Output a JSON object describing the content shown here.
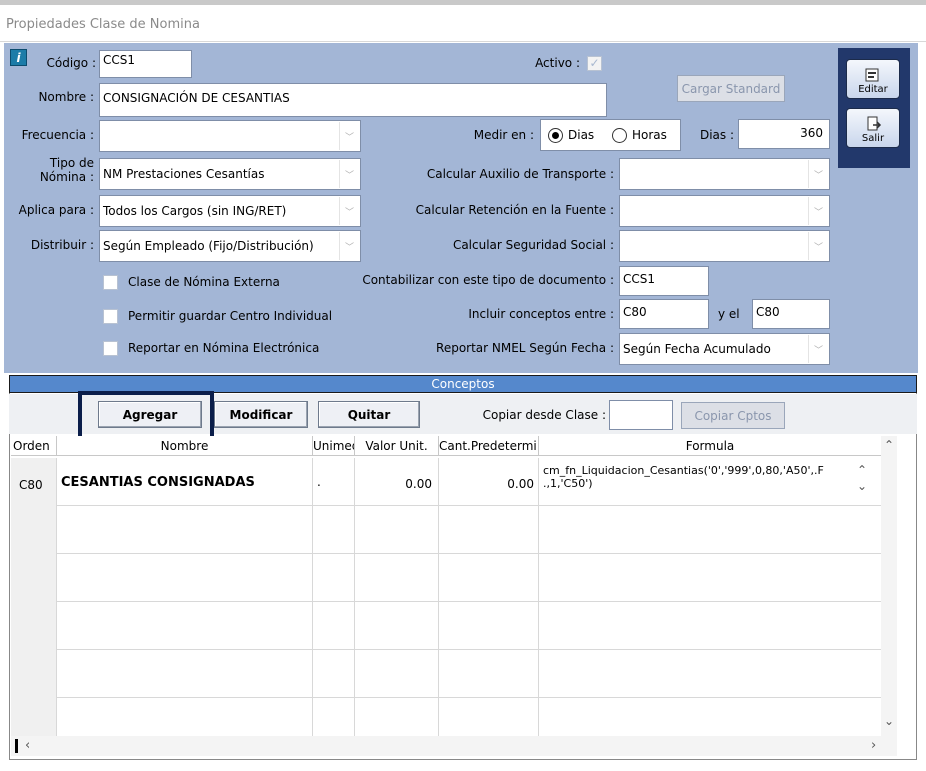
{
  "window": {
    "title": "Propiedades Clase de Nomina"
  },
  "form": {
    "codigo_label": "Código :",
    "codigo_value": "CCS1",
    "activo_label": "Activo :",
    "activo_check": "✓",
    "nombre_label": "Nombre :",
    "nombre_value": "CONSIGNACIÓN DE CESANTIAS",
    "cargar_standard": "Cargar Standard",
    "frecuencia_label": "Frecuencia :",
    "frecuencia_value": "",
    "medir_en_label": "Medir en :",
    "radio_dias": "Dias",
    "radio_horas": "Horas",
    "dias_label": "Dias :",
    "dias_value": "360",
    "tipo_nomina_label_1": "Tipo de",
    "tipo_nomina_label_2": "Nómina :",
    "tipo_nomina_value": "NM Prestaciones Cesantías",
    "aux_transporte_label": "Calcular Auxilio de Transporte :",
    "aux_transporte_value": "",
    "aplica_para_label": "Aplica para :",
    "aplica_para_value": "Todos los Cargos (sin ING/RET)",
    "retencion_label": "Calcular Retención en la Fuente :",
    "retencion_value": "",
    "distribuir_label": "Distribuir :",
    "distribuir_value": "Según Empleado (Fijo/Distribución)",
    "seguridad_label": "Calcular Seguridad Social :",
    "seguridad_value": "",
    "clase_externa": "Clase de Nómina Externa",
    "contabilizar_label": "Contabilizar con este tipo de documento :",
    "contabilizar_value": "CCS1",
    "permitir_centro": "Permitir guardar Centro Individual",
    "incluir_label": "Incluir conceptos entre :",
    "incluir_from": "C80",
    "incluir_y_el": "y el",
    "incluir_to": "C80",
    "reportar_electronica": "Reportar en Nómina Electrónica",
    "reportar_nmel_label": "Reportar NMEL Según Fecha :",
    "reportar_nmel_value": "Según Fecha Acumulado"
  },
  "side": {
    "editar": "Editar",
    "salir": "Salir"
  },
  "conceptos": {
    "title": "Conceptos",
    "agregar": "Agregar",
    "modificar": "Modificar",
    "quitar": "Quitar",
    "copiar_label": "Copiar desde Clase :",
    "copiar_value": "",
    "copiar_btn": "Copiar Cptos",
    "columns": [
      "Orden",
      "Nombre",
      "Unimed",
      "Valor Unit.",
      "Cant.Predetermi",
      "Formula"
    ],
    "rows": [
      {
        "orden": "C80",
        "nombre": "CESANTIAS CONSIGNADAS",
        "unimed": ".",
        "valor": "0.00",
        "cant": "0.00",
        "formula_1": "cm_fn_Liquidacion_Cesantias('0','999',0,80,'A50',.F",
        "formula_2": ".,1,'C50')"
      }
    ]
  }
}
